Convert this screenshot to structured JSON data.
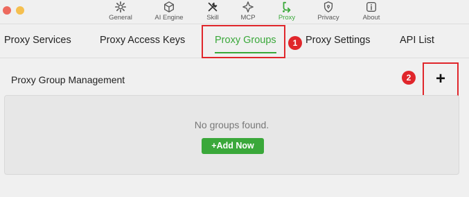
{
  "toolbar": {
    "items": [
      {
        "label": "General",
        "icon": "gear-icon"
      },
      {
        "label": "AI Engine",
        "icon": "cube-icon"
      },
      {
        "label": "Skill",
        "icon": "tools-icon"
      },
      {
        "label": "MCP",
        "icon": "mcp-icon"
      },
      {
        "label": "Proxy",
        "icon": "proxy-icon",
        "active": true
      },
      {
        "label": "Privacy",
        "icon": "shield-icon"
      },
      {
        "label": "About",
        "icon": "info-icon"
      }
    ]
  },
  "tabs": [
    {
      "label": "Proxy Services"
    },
    {
      "label": "Proxy Access Keys"
    },
    {
      "label": "Proxy Groups",
      "active": true
    },
    {
      "label": "Proxy Settings"
    },
    {
      "label": "API List"
    }
  ],
  "annotations": {
    "marker1": "1",
    "marker2": "2"
  },
  "section": {
    "title": "Proxy Group Management",
    "add_icon": "+"
  },
  "groups": {
    "empty_text": "No groups found.",
    "add_now_label": "+Add Now"
  },
  "colors": {
    "accent": "#3aa83a",
    "highlight": "#e0262b"
  }
}
